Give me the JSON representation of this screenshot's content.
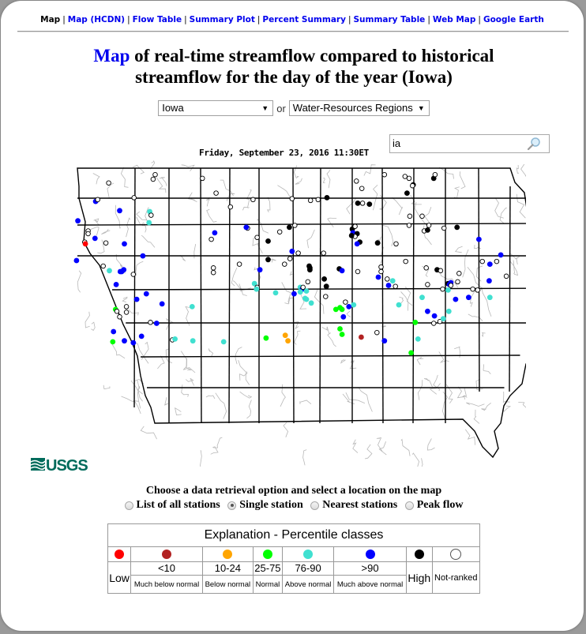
{
  "nav": {
    "current": "Map",
    "links": [
      "Map (HCDN)",
      "Flow Table",
      "Summary Plot",
      "Percent Summary",
      "Summary Table",
      "Web Map",
      "Google Earth"
    ]
  },
  "title": {
    "link": "Map",
    "line1_rest": " of real-time streamflow compared to historical",
    "line2": "streamflow for the day of the year (Iowa)"
  },
  "selectors": {
    "state": "Iowa",
    "or_label": "or",
    "region": "Water-Resources Regions"
  },
  "map": {
    "datestamp": "Friday, September 23, 2016 11:30ET",
    "search_value": "ia",
    "logo": "USGS",
    "stations": [
      [
        -96.16,
        43.34,
        "nr"
      ],
      [
        -96.35,
        43.14,
        "mab"
      ],
      [
        -96.32,
        43.16,
        "nr"
      ],
      [
        -95.79,
        43.18,
        "nr"
      ],
      [
        -95.48,
        43.43,
        "nr"
      ],
      [
        -95.51,
        43.38,
        "nr"
      ],
      [
        -94.79,
        43.39,
        "nr"
      ],
      [
        -94.59,
        43.23,
        "nr"
      ],
      [
        -94.05,
        43.16,
        "nr"
      ],
      [
        -93.48,
        43.17,
        "nr"
      ],
      [
        -93.1,
        43.16,
        "nr"
      ],
      [
        -92.97,
        43.18,
        "hi"
      ],
      [
        -93.21,
        43.15,
        "nr"
      ],
      [
        -92.54,
        43.36,
        "nr"
      ],
      [
        -92.46,
        43.28,
        "nr"
      ],
      [
        -92.45,
        43.12,
        "nr"
      ],
      [
        -92.13,
        43.43,
        "nr"
      ],
      [
        -91.83,
        43.41,
        "nr"
      ],
      [
        -91.77,
        43.39,
        "nr"
      ],
      [
        -91.71,
        43.32,
        "hi"
      ],
      [
        -91.72,
        43.31,
        "nr"
      ],
      [
        -91.8,
        43.23,
        "hi"
      ],
      [
        -91.41,
        43.39,
        "hi"
      ],
      [
        -91.39,
        43.43,
        "nr"
      ],
      [
        -92.52,
        43.12,
        "hi"
      ],
      [
        -92.35,
        43.11,
        "hi"
      ],
      [
        -95.56,
        43.03,
        "ab"
      ],
      [
        -96.0,
        43.04,
        "mab"
      ],
      [
        -96.61,
        42.93,
        "mab"
      ],
      [
        -95.57,
        42.91,
        "ab"
      ],
      [
        -95.54,
        42.99,
        "nr"
      ],
      [
        -96.46,
        42.82,
        "nr"
      ],
      [
        -96.46,
        42.79,
        "nr"
      ],
      [
        -96.36,
        42.74,
        "mab"
      ],
      [
        -96.51,
        42.7,
        "nr"
      ],
      [
        -96.5,
        42.68,
        "low"
      ],
      [
        -96.2,
        42.69,
        "nr"
      ],
      [
        -95.93,
        42.68,
        "mab"
      ],
      [
        -96.63,
        42.5,
        "mab"
      ],
      [
        -96.15,
        42.39,
        "ab"
      ],
      [
        -95.94,
        42.4,
        "mab"
      ],
      [
        -94.38,
        43.08,
        "nr"
      ],
      [
        -94.13,
        42.85,
        "nr"
      ],
      [
        -94.15,
        42.86,
        "mab"
      ],
      [
        -93.99,
        42.75,
        "nr"
      ],
      [
        -93.83,
        42.71,
        "hi"
      ],
      [
        -93.66,
        42.81,
        "nr"
      ],
      [
        -93.52,
        42.86,
        "hi"
      ],
      [
        -93.44,
        42.88,
        "nr"
      ],
      [
        -93.39,
        42.58,
        "nr"
      ],
      [
        -93.02,
        42.58,
        "nr"
      ],
      [
        -93.83,
        42.51,
        "hi"
      ],
      [
        -93.48,
        42.6,
        "mab"
      ],
      [
        -93.51,
        42.52,
        "nr"
      ],
      [
        -92.6,
        42.84,
        "hi"
      ],
      [
        -92.56,
        42.87,
        "nr"
      ],
      [
        -92.59,
        42.8,
        "mab"
      ],
      [
        -92.53,
        42.79,
        "hi"
      ],
      [
        -92.56,
        42.76,
        "nr"
      ],
      [
        -92.61,
        42.77,
        "hi"
      ],
      [
        -92.49,
        42.7,
        "hi"
      ],
      [
        -92.53,
        42.68,
        "mab"
      ],
      [
        -92.23,
        42.69,
        "hi"
      ],
      [
        -91.96,
        42.68,
        "nr"
      ],
      [
        -91.76,
        42.98,
        "nr"
      ],
      [
        -91.77,
        42.88,
        "nr"
      ],
      [
        -91.58,
        42.98,
        "nr"
      ],
      [
        -91.55,
        42.82,
        "nr"
      ],
      [
        -91.5,
        42.83,
        "hi"
      ],
      [
        -91.48,
        42.88,
        "nr"
      ],
      [
        -91.26,
        42.85,
        "nr"
      ],
      [
        -91.07,
        42.86,
        "hi"
      ],
      [
        -90.75,
        42.73,
        "mab"
      ],
      [
        -94.61,
        42.8,
        "mab"
      ],
      [
        -94.66,
        42.73,
        "nr"
      ],
      [
        -95.66,
        42.55,
        "mab"
      ],
      [
        -95.97,
        42.38,
        "mab"
      ],
      [
        -95.99,
        42.38,
        "mab"
      ],
      [
        -96.24,
        42.44,
        "nr"
      ],
      [
        -95.8,
        42.35,
        "nr"
      ],
      [
        -96.05,
        42.24,
        "mab"
      ],
      [
        -95.61,
        42.14,
        "mab"
      ],
      [
        -94.63,
        42.42,
        "nr"
      ],
      [
        -94.63,
        42.37,
        "nr"
      ],
      [
        -94.25,
        42.46,
        "nr"
      ],
      [
        -93.95,
        42.4,
        "mab"
      ],
      [
        -93.59,
        42.46,
        "nr"
      ],
      [
        -93.23,
        42.44,
        "hi"
      ],
      [
        -93.22,
        42.42,
        "hi"
      ],
      [
        -93.22,
        42.4,
        "hi"
      ],
      [
        -92.79,
        42.41,
        "hi"
      ],
      [
        -92.75,
        42.39,
        "mab"
      ],
      [
        -92.52,
        42.38,
        "nr"
      ],
      [
        -92.18,
        42.38,
        "nr"
      ],
      [
        -92.18,
        42.43,
        "nr"
      ],
      [
        -92.22,
        42.32,
        "mab"
      ],
      [
        -92.09,
        42.3,
        "nr"
      ],
      [
        -92.01,
        42.28,
        "ab"
      ],
      [
        -91.82,
        42.49,
        "nr"
      ],
      [
        -91.52,
        42.42,
        "nr"
      ],
      [
        -91.36,
        42.4,
        "hi"
      ],
      [
        -91.31,
        42.39,
        "nr"
      ],
      [
        -91.04,
        42.36,
        "nr"
      ],
      [
        -90.7,
        42.49,
        "nr"
      ],
      [
        -90.59,
        42.46,
        "mab"
      ],
      [
        -90.43,
        42.56,
        "mab"
      ],
      [
        -90.49,
        42.49,
        "nr"
      ],
      [
        -90.35,
        42.33,
        "nr"
      ],
      [
        -94.03,
        42.25,
        "ab"
      ],
      [
        -93.99,
        42.21,
        "nr"
      ],
      [
        -94.0,
        42.19,
        "ab"
      ],
      [
        -93.72,
        42.15,
        "ab"
      ],
      [
        -93.45,
        42.14,
        "mab"
      ],
      [
        -93.36,
        42.21,
        "ab"
      ],
      [
        -93.33,
        42.19,
        "mab"
      ],
      [
        -93.36,
        42.16,
        "ab"
      ],
      [
        -93.27,
        42.17,
        "ab"
      ],
      [
        -93.32,
        42.21,
        "nr"
      ],
      [
        -93.25,
        42.27,
        "nr"
      ],
      [
        -93.01,
        42.3,
        "hi"
      ],
      [
        -92.98,
        42.22,
        "hi"
      ],
      [
        -92.99,
        42.11,
        "nr"
      ],
      [
        -93.29,
        42.09,
        "ab"
      ],
      [
        -93.27,
        42.08,
        "ab"
      ],
      [
        -93.2,
        42.04,
        "ab"
      ],
      [
        -92.07,
        42.23,
        "mab"
      ],
      [
        -91.97,
        42.22,
        "nr"
      ],
      [
        -91.5,
        42.24,
        "nr"
      ],
      [
        -91.2,
        42.25,
        "hi"
      ],
      [
        -91.16,
        42.26,
        "mab"
      ],
      [
        -91.18,
        42.24,
        "mab"
      ],
      [
        -91.16,
        42.23,
        "nr"
      ],
      [
        -91.06,
        42.27,
        "nr"
      ],
      [
        -91.2,
        42.18,
        "ab"
      ],
      [
        -91.28,
        42.19,
        "nr"
      ],
      [
        -90.84,
        42.19,
        "nr"
      ],
      [
        -90.77,
        42.18,
        "nr"
      ],
      [
        -91.09,
        42.08,
        "mab"
      ],
      [
        -90.9,
        42.1,
        "mab"
      ],
      [
        -90.59,
        42.1,
        "ab"
      ],
      [
        -90.6,
        42.28,
        "mab"
      ],
      [
        -91.58,
        42.1,
        "ab"
      ],
      [
        -95.75,
        42.08,
        "mab"
      ],
      [
        -95.38,
        42.03,
        "mab"
      ],
      [
        -94.94,
        42.0,
        "ab"
      ],
      [
        -95.9,
        42.0,
        "nr"
      ],
      [
        -96.06,
        41.97,
        "gr"
      ],
      [
        -96.04,
        41.95,
        "nr"
      ],
      [
        -95.9,
        41.94,
        "nr"
      ],
      [
        -96.0,
        41.89,
        "nr"
      ],
      [
        -95.55,
        41.83,
        "nr"
      ],
      [
        -95.46,
        41.82,
        "mab"
      ],
      [
        -92.84,
        41.97,
        "gr"
      ],
      [
        -92.78,
        41.99,
        "gr"
      ],
      [
        -92.75,
        41.97,
        "gr"
      ],
      [
        -92.65,
        42.0,
        "mab"
      ],
      [
        -92.7,
        42.05,
        "nr"
      ],
      [
        -92.58,
        42.02,
        "ab"
      ],
      [
        -91.92,
        42.02,
        "ab"
      ],
      [
        -91.5,
        41.95,
        "mab"
      ],
      [
        -91.4,
        41.9,
        "mab"
      ],
      [
        -91.32,
        41.84,
        "nr"
      ],
      [
        -91.27,
        41.87,
        "ab"
      ],
      [
        -91.19,
        41.95,
        "ab"
      ],
      [
        -91.41,
        41.82,
        "nr"
      ],
      [
        -91.68,
        41.83,
        "gr"
      ],
      [
        -96.09,
        41.73,
        "mab"
      ],
      [
        -95.93,
        41.63,
        "mab"
      ],
      [
        -95.68,
        41.68,
        "mab"
      ],
      [
        -96.1,
        41.62,
        "gr"
      ],
      [
        -95.8,
        41.61,
        "mab"
      ],
      [
        -95.23,
        41.64,
        "nr"
      ],
      [
        -95.19,
        41.65,
        "ab"
      ],
      [
        -94.93,
        41.63,
        "ab"
      ],
      [
        -94.48,
        41.62,
        "ab"
      ],
      [
        -93.86,
        41.66,
        "gr"
      ],
      [
        -93.58,
        41.69,
        "orange"
      ],
      [
        -93.54,
        41.63,
        "orange"
      ],
      [
        -92.78,
        41.76,
        "gr"
      ],
      [
        -92.75,
        41.7,
        "gr"
      ],
      [
        -92.47,
        41.67,
        "low2"
      ],
      [
        -92.13,
        41.63,
        "mab"
      ],
      [
        -92.24,
        41.72,
        "nr"
      ],
      [
        -91.64,
        41.65,
        "ab"
      ],
      [
        -91.74,
        41.5,
        "gr"
      ],
      [
        -92.73,
        41.89,
        "mab"
      ]
    ]
  },
  "options": {
    "prompt": "Choose a data retrieval option and select a location on the map",
    "radios": [
      {
        "label": "List of all stations",
        "checked": false
      },
      {
        "label": "Single station",
        "checked": true
      },
      {
        "label": "Nearest stations",
        "checked": false
      },
      {
        "label": "Peak flow",
        "checked": false
      }
    ]
  },
  "legend": {
    "title": "Explanation - Percentile classes",
    "classes": [
      {
        "key": "low",
        "color": "#ff0000",
        "range": "Low",
        "desc": ""
      },
      {
        "key": "mbn",
        "color": "#b22222",
        "range": "<10",
        "desc": "Much below normal"
      },
      {
        "key": "bn",
        "color": "#ffa500",
        "range": "10-24",
        "desc": "Below normal"
      },
      {
        "key": "n",
        "color": "#00ff00",
        "range": "25-75",
        "desc": "Normal"
      },
      {
        "key": "an",
        "color": "#40e0d0",
        "range": "76-90",
        "desc": "Above normal"
      },
      {
        "key": "man",
        "color": "#0000ff",
        "range": ">90",
        "desc": "Much above normal"
      },
      {
        "key": "hi",
        "color": "#000000",
        "range": "High",
        "desc": ""
      },
      {
        "key": "nr",
        "color": "#ffffff",
        "range": "Not-ranked",
        "desc": ""
      }
    ]
  }
}
